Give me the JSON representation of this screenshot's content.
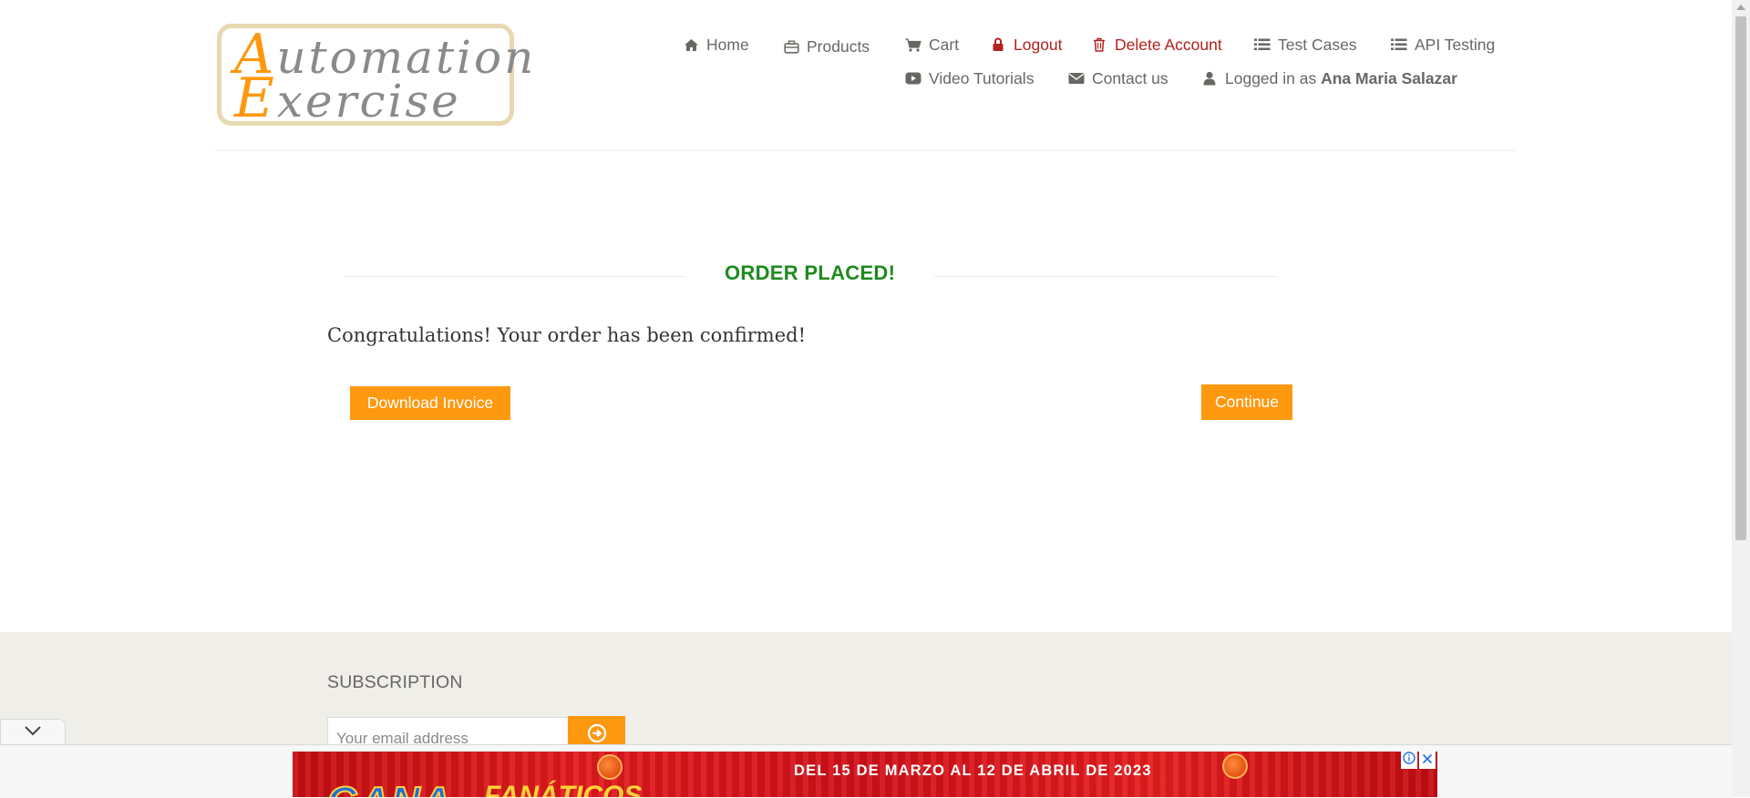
{
  "logo": {
    "line1_cap": "A",
    "line1_rest": "utomation",
    "line2_cap": "E",
    "line2_rest": "xercise"
  },
  "nav": {
    "home": "Home",
    "products": "Products",
    "cart": "Cart",
    "logout": "Logout",
    "delete_account": "Delete Account",
    "test_cases": "Test Cases",
    "api_testing": "API Testing",
    "video_tutorials": "Video Tutorials",
    "contact_us": "Contact us",
    "logged_in_prefix": "Logged in as",
    "logged_in_user": "Ana Maria Salazar"
  },
  "main": {
    "order_title": "ORDER PLACED!",
    "confirmation": "Congratulations! Your order has been confirmed!",
    "download_invoice": "Download Invoice",
    "continue": "Continue"
  },
  "footer": {
    "subscription_title": "SUBSCRIPTION",
    "email_placeholder": "Your email address"
  },
  "ad": {
    "headline": "DEL 15 DE MARZO AL 12 DE ABRIL DE 2023",
    "brand_part1": "GANA",
    "brand_part2": "FANÁTICOS"
  },
  "colors": {
    "accent": "#fe980f",
    "success": "#1e8a1e",
    "danger": "#b22020",
    "footer_bg": "#efeee8"
  },
  "icons": {
    "home": "home-icon",
    "products": "briefcase-icon",
    "cart": "cart-icon",
    "logout": "lock-icon",
    "delete": "trash-icon",
    "test_cases": "list-icon",
    "api": "list-icon",
    "video": "youtube-icon",
    "contact": "envelope-icon",
    "user": "user-icon",
    "subscribe": "arrow-circle-right-icon",
    "collapse": "chevron-down-icon",
    "ad_info": "info-icon",
    "ad_close": "close-icon"
  }
}
